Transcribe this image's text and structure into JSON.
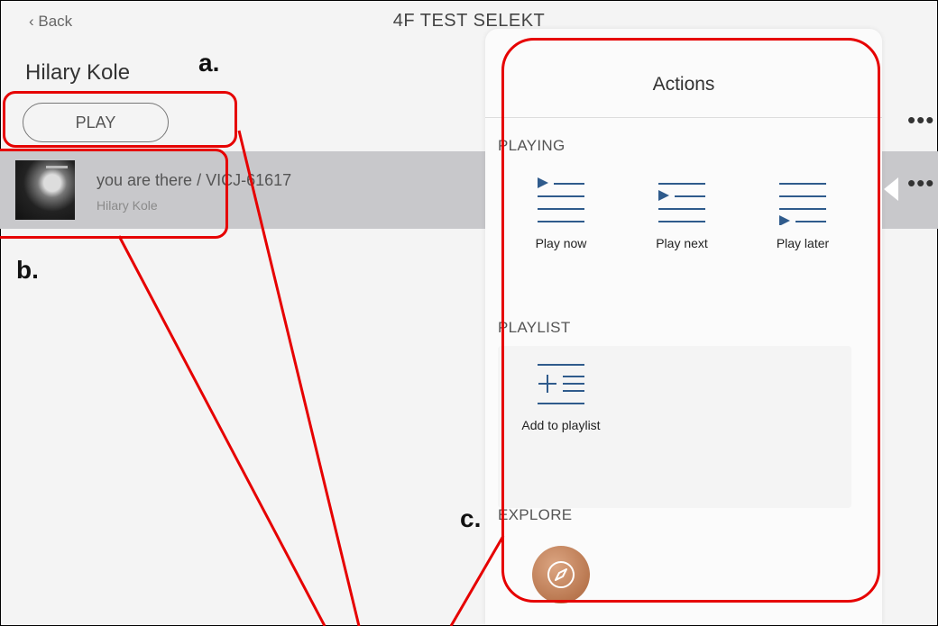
{
  "header": {
    "back_label": "‹ Back",
    "title": "4F TEST SELEKT"
  },
  "artist_name": "Hilary Kole",
  "play_label": "PLAY",
  "more_label": "•••",
  "track": {
    "title": "you are there / VICJ-61617",
    "artist": "Hilary Kole",
    "art_icon": "album-art"
  },
  "actions": {
    "title": "Actions",
    "sections": {
      "playing": "PLAYING",
      "playlist": "PLAYLIST",
      "explore": "EXPLORE"
    },
    "items": {
      "play_now": "Play now",
      "play_next": "Play next",
      "play_later": "Play later",
      "add_to_playlist": "Add to playlist"
    },
    "icon_color": "#2f5b8c",
    "explore_icon": "compass-icon"
  },
  "annotations": {
    "a": "a.",
    "b": "b.",
    "c": "c.",
    "color": "#e60000"
  }
}
